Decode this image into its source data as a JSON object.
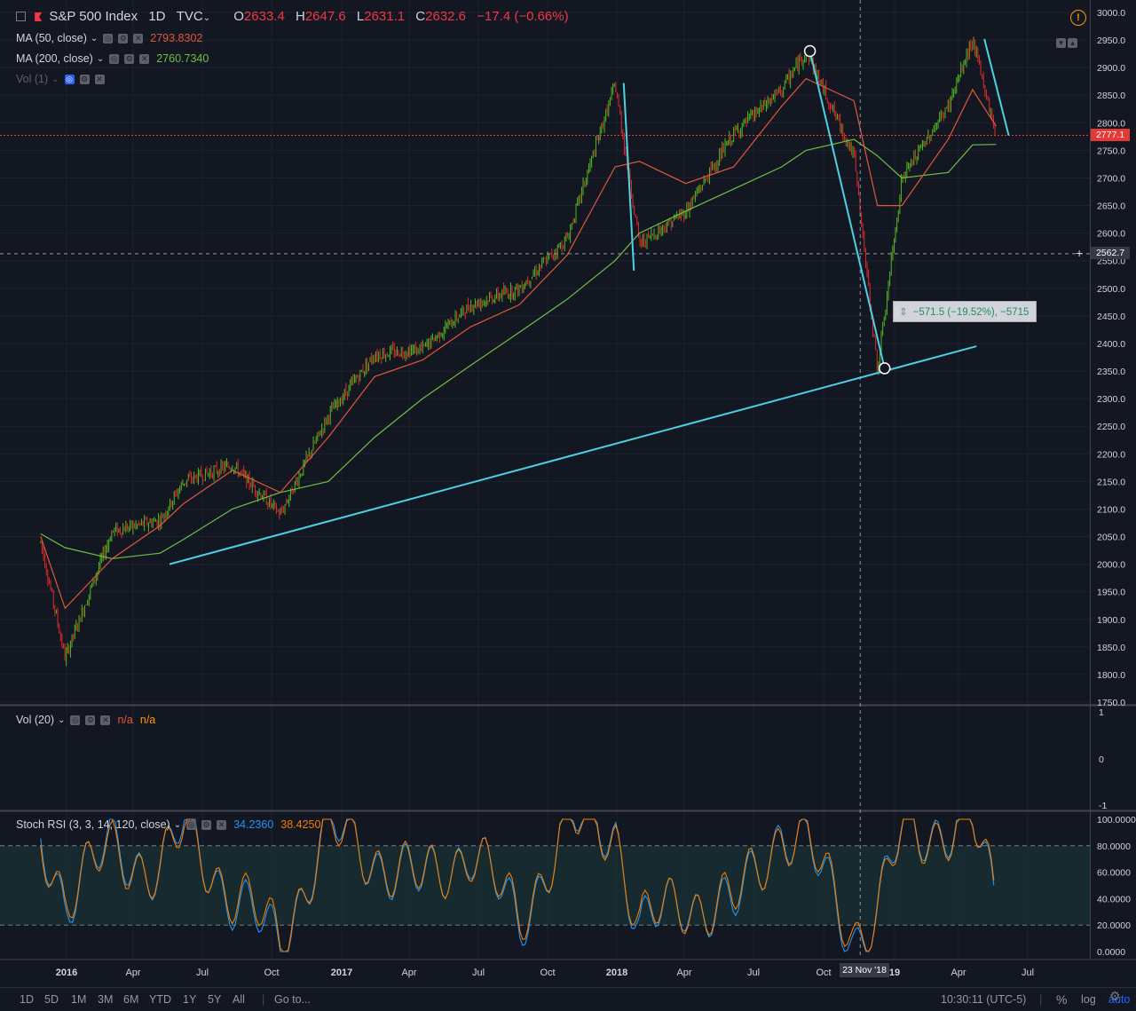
{
  "header": {
    "symbol_name": "S&P 500 Index",
    "interval": "1D",
    "exchange": "TVC",
    "open_label": "O",
    "open_value": "2633.4",
    "high_label": "H",
    "high_value": "2647.6",
    "low_label": "L",
    "low_value": "2631.1",
    "close_label": "C",
    "close_value": "2632.6",
    "change": "−17.4 (−0.66%)"
  },
  "indicators": {
    "ma50": {
      "label": "MA (50, close)",
      "value": "2793.8302",
      "color": "#e0573b"
    },
    "ma200": {
      "label": "MA (200, close)",
      "value": "2760.7340",
      "color": "#6ec044"
    },
    "vol_overlay": {
      "label": "Vol (1)"
    },
    "vol20": {
      "label": "Vol (20)",
      "value1": "n/a",
      "value2": "n/a"
    },
    "stoch": {
      "label": "Stoch RSI (3, 3, 14, 120, close)",
      "k_value": "34.2360",
      "d_value": "38.4250",
      "k_color": "#2196f3",
      "d_color": "#f57c00"
    }
  },
  "price_axis": {
    "ticks": [
      "3000.0",
      "2950.0",
      "2900.0",
      "2850.0",
      "2800.0",
      "2750.0",
      "2700.0",
      "2650.0",
      "2600.0",
      "2550.0",
      "2500.0",
      "2450.0",
      "2400.0",
      "2350.0",
      "2300.0",
      "2250.0",
      "2200.0",
      "2150.0",
      "2100.0",
      "2050.0",
      "2000.0",
      "1950.0",
      "1900.0",
      "1850.0",
      "1800.0",
      "1750.0"
    ],
    "current_price_label": "2777.1",
    "crosshair_price_label": "2562.7"
  },
  "vol_axis": {
    "ticks": [
      "1",
      "0",
      "-1"
    ]
  },
  "stoch_axis": {
    "ticks": [
      "100.0000",
      "80.0000",
      "60.0000",
      "40.0000",
      "20.0000",
      "0.0000"
    ]
  },
  "time_axis": {
    "labels": [
      "2016",
      "Apr",
      "Jul",
      "Oct",
      "2017",
      "Apr",
      "Jul",
      "Oct",
      "2018",
      "Apr",
      "Jul",
      "Oct",
      "19",
      "Apr",
      "Jul"
    ],
    "crosshair_date": "23 Nov '18"
  },
  "measure_tooltip": "−571.5 (−19.52%), −5715",
  "bottom_bar": {
    "ranges": [
      "1D",
      "5D",
      "1M",
      "3M",
      "6M",
      "YTD",
      "1Y",
      "5Y",
      "All"
    ],
    "goto": "Go to...",
    "clock": "10:30:11 (UTC-5)",
    "percent": "%",
    "log": "log",
    "auto": "auto"
  },
  "colors": {
    "background": "#131722",
    "up_candle": "#53b91f",
    "down_candle": "#e02b2b",
    "drawing": "#4dd0e1",
    "grid": "#1e2230"
  },
  "chart_data": [
    {
      "type": "line",
      "title": "S&P 500 Index, 1D, TVC",
      "y_axis_range": [
        1750,
        3000
      ],
      "x": [
        "2016-01",
        "2016-02",
        "2016-04",
        "2016-06",
        "2016-07",
        "2016-09",
        "2016-11",
        "2017-01",
        "2017-03",
        "2017-05",
        "2017-07",
        "2017-09",
        "2017-11",
        "2018-01",
        "2018-02",
        "2018-04",
        "2018-06",
        "2018-08",
        "2018-09",
        "2018-11",
        "2018-12",
        "2019-01",
        "2019-03",
        "2019-04",
        "2019-05"
      ],
      "series": [
        {
          "name": "S&P 500 Index",
          "values": [
            2040,
            1830,
            2060,
            2080,
            2150,
            2180,
            2090,
            2270,
            2380,
            2390,
            2470,
            2500,
            2590,
            2870,
            2580,
            2640,
            2780,
            2860,
            2930,
            2740,
            2350,
            2700,
            2830,
            2950,
            2777
          ]
        },
        {
          "name": "MA (50, close)",
          "values": [
            2050,
            1920,
            2010,
            2070,
            2110,
            2170,
            2130,
            2230,
            2340,
            2370,
            2430,
            2470,
            2560,
            2720,
            2730,
            2690,
            2720,
            2830,
            2880,
            2840,
            2650,
            2650,
            2770,
            2860,
            2793.83
          ]
        },
        {
          "name": "MA (200, close)",
          "values": [
            2055,
            2030,
            2010,
            2020,
            2045,
            2100,
            2130,
            2150,
            2230,
            2300,
            2360,
            2420,
            2480,
            2550,
            2600,
            2640,
            2680,
            2720,
            2750,
            2770,
            2740,
            2700,
            2710,
            2760,
            2760.73
          ]
        }
      ]
    },
    {
      "type": "line",
      "title": "Stoch RSI (3, 3, 14, 120, close)",
      "y_axis_range": [
        0,
        100
      ],
      "x": [
        "2016-01",
        "2016-02",
        "2016-04",
        "2016-06",
        "2016-07",
        "2016-09",
        "2016-11",
        "2017-01",
        "2017-03",
        "2017-05",
        "2017-07",
        "2017-09",
        "2017-11",
        "2018-01",
        "2018-02",
        "2018-04",
        "2018-06",
        "2018-08",
        "2018-09",
        "2018-11",
        "2018-12",
        "2019-01",
        "2019-03",
        "2019-04",
        "2019-05"
      ],
      "series": [
        {
          "name": "K",
          "values": [
            90,
            40,
            80,
            60,
            95,
            40,
            5,
            95,
            70,
            50,
            80,
            20,
            97,
            95,
            15,
            40,
            30,
            95,
            80,
            10,
            30,
            90,
            95,
            97,
            34.24
          ]
        },
        {
          "name": "D",
          "values": [
            85,
            45,
            75,
            62,
            90,
            45,
            10,
            90,
            72,
            52,
            78,
            25,
            95,
            93,
            20,
            38,
            35,
            92,
            82,
            15,
            28,
            88,
            93,
            96,
            38.43
          ]
        }
      ]
    }
  ]
}
